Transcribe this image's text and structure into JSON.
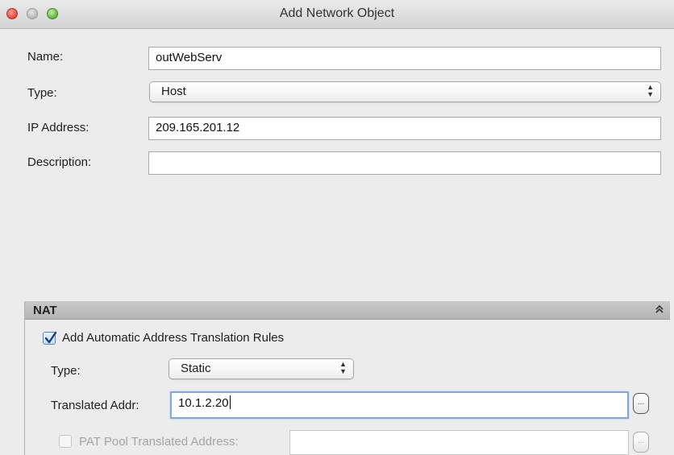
{
  "window": {
    "title": "Add Network Object"
  },
  "form": {
    "name_label": "Name:",
    "name_value": "outWebServ",
    "type_label": "Type:",
    "type_value": "Host",
    "ip_label": "IP Address:",
    "ip_value": "209.165.201.12",
    "description_label": "Description:",
    "description_value": ""
  },
  "nat": {
    "title": "NAT",
    "auto_rules_label": "Add Automatic Address Translation Rules",
    "auto_rules_checked": true,
    "type_label": "Type:",
    "type_value": "Static",
    "translated_label": "Translated Addr:",
    "translated_value": "10.1.2.20",
    "browse_label": "...",
    "pat_label": "PAT Pool Translated Address:",
    "pat_checked": false,
    "pat_value": ""
  },
  "icons": {
    "close": "close-icon",
    "minimize": "minimize-icon",
    "zoom": "zoom-icon",
    "select_arrows": "updown-arrows-icon",
    "collapse": "chevron-double-up-icon",
    "checkmark": "checkmark-icon"
  },
  "colors": {
    "close_button": "#e0463b",
    "zoom_button": "#62b540",
    "focus_ring": "#7fa7d8",
    "panel_header": "#bdbdbd"
  }
}
